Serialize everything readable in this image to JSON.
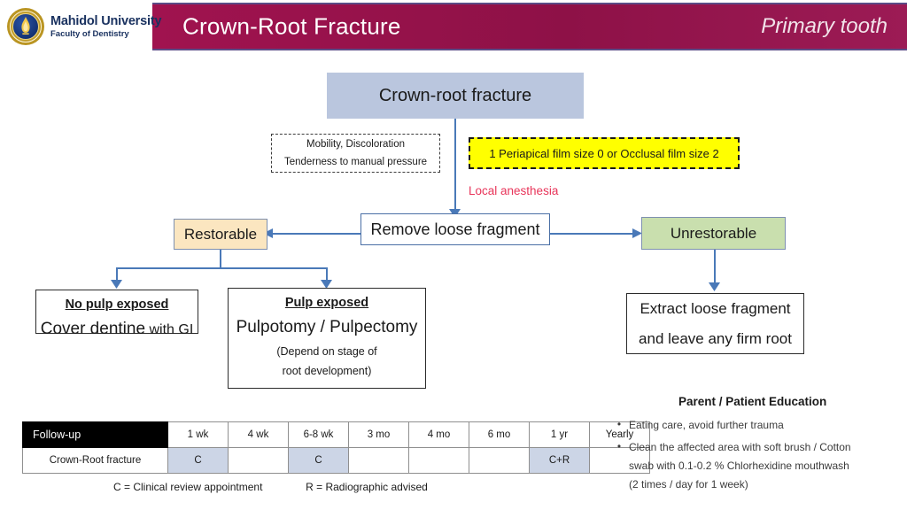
{
  "header": {
    "title": "Crown-Root Fracture",
    "subtitle": "Primary tooth",
    "bar_color": "#9e1250"
  },
  "logo": {
    "name": "Mahidol University",
    "faculty": "Faculty of Dentistry",
    "seal_icon": "mahidol-seal-icon"
  },
  "flowchart": {
    "top_box": "Crown-root fracture",
    "signs_box": {
      "line1": "Mobility, Discoloration",
      "line2": "Tenderness to manual pressure"
    },
    "radiograph_box": "1 Periapical film size 0 or Occlusal film size 2",
    "local_anesthesia": "Local anesthesia",
    "remove_box": "Remove loose fragment",
    "restorable_box": "Restorable",
    "unrestorable_box": "Unrestorable",
    "no_pulp_box": {
      "title": "No pulp exposed",
      "main": "Cover dentine",
      "main_small": "with GI"
    },
    "pulp_box": {
      "title": "Pulp exposed",
      "main": "Pulpotomy / Pulpectomy",
      "sub1": "(Depend on stage of",
      "sub2": "root development)"
    },
    "extract_box": {
      "line1": "Extract loose fragment",
      "line2": "and leave any firm root"
    }
  },
  "followup_table": {
    "row_header_label": "Follow-up",
    "columns": [
      "1 wk",
      "4 wk",
      "6-8 wk",
      "3 mo",
      "4 mo",
      "6 mo",
      "1 yr",
      "Yearly"
    ],
    "row_label": "Crown-Root fracture",
    "values": [
      "C",
      "",
      "C",
      "",
      "",
      "",
      "C+R",
      ""
    ],
    "highlight_color": "#ccd5e6"
  },
  "legend": {
    "clinical": "C = Clinical review appointment",
    "radiographic": "R = Radiographic advised"
  },
  "education": {
    "title": "Parent / Patient Education",
    "items": [
      {
        "lines": [
          "Eating care, avoid further trauma"
        ]
      },
      {
        "lines": [
          "Clean the affected area with soft brush / Cotton",
          "swab with 0.1-0.2 % Chlorhexidine mouthwash",
          "(2 times / day for 1 week)"
        ]
      }
    ],
    "bullet": "•"
  }
}
